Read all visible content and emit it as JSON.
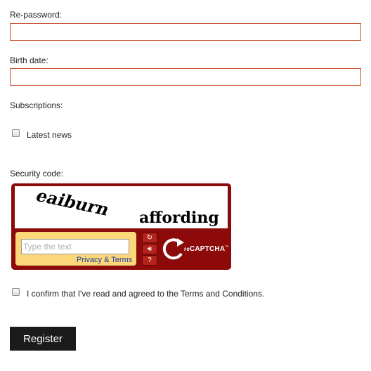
{
  "form": {
    "repassword": {
      "label": "Re-password:",
      "value": ""
    },
    "birth_date": {
      "label": "Birth date:",
      "value": ""
    },
    "subscriptions": {
      "label": "Subscriptions:",
      "latest_news": {
        "label": "Latest news",
        "checked": false
      }
    },
    "security_code": {
      "label": "Security code:"
    },
    "terms": {
      "label": "I confirm that I've read and agreed to the Terms and Conditions.",
      "checked": false
    },
    "register_label": "Register"
  },
  "captcha": {
    "challenge_words": [
      "eaiburn",
      "affording"
    ],
    "input_placeholder": "Type the text",
    "privacy_link": "Privacy & Terms",
    "logo_prefix": "re",
    "logo_text": "CAPTCHA",
    "logo_tm": "™",
    "buttons": [
      "refresh-icon",
      "audio-icon",
      "help-icon"
    ]
  },
  "colors": {
    "field_border": "#c8532f",
    "captcha_frame": "#8c0a0a",
    "captcha_entry_bg": "#fbd779",
    "register_bg": "#1b1b1b"
  }
}
